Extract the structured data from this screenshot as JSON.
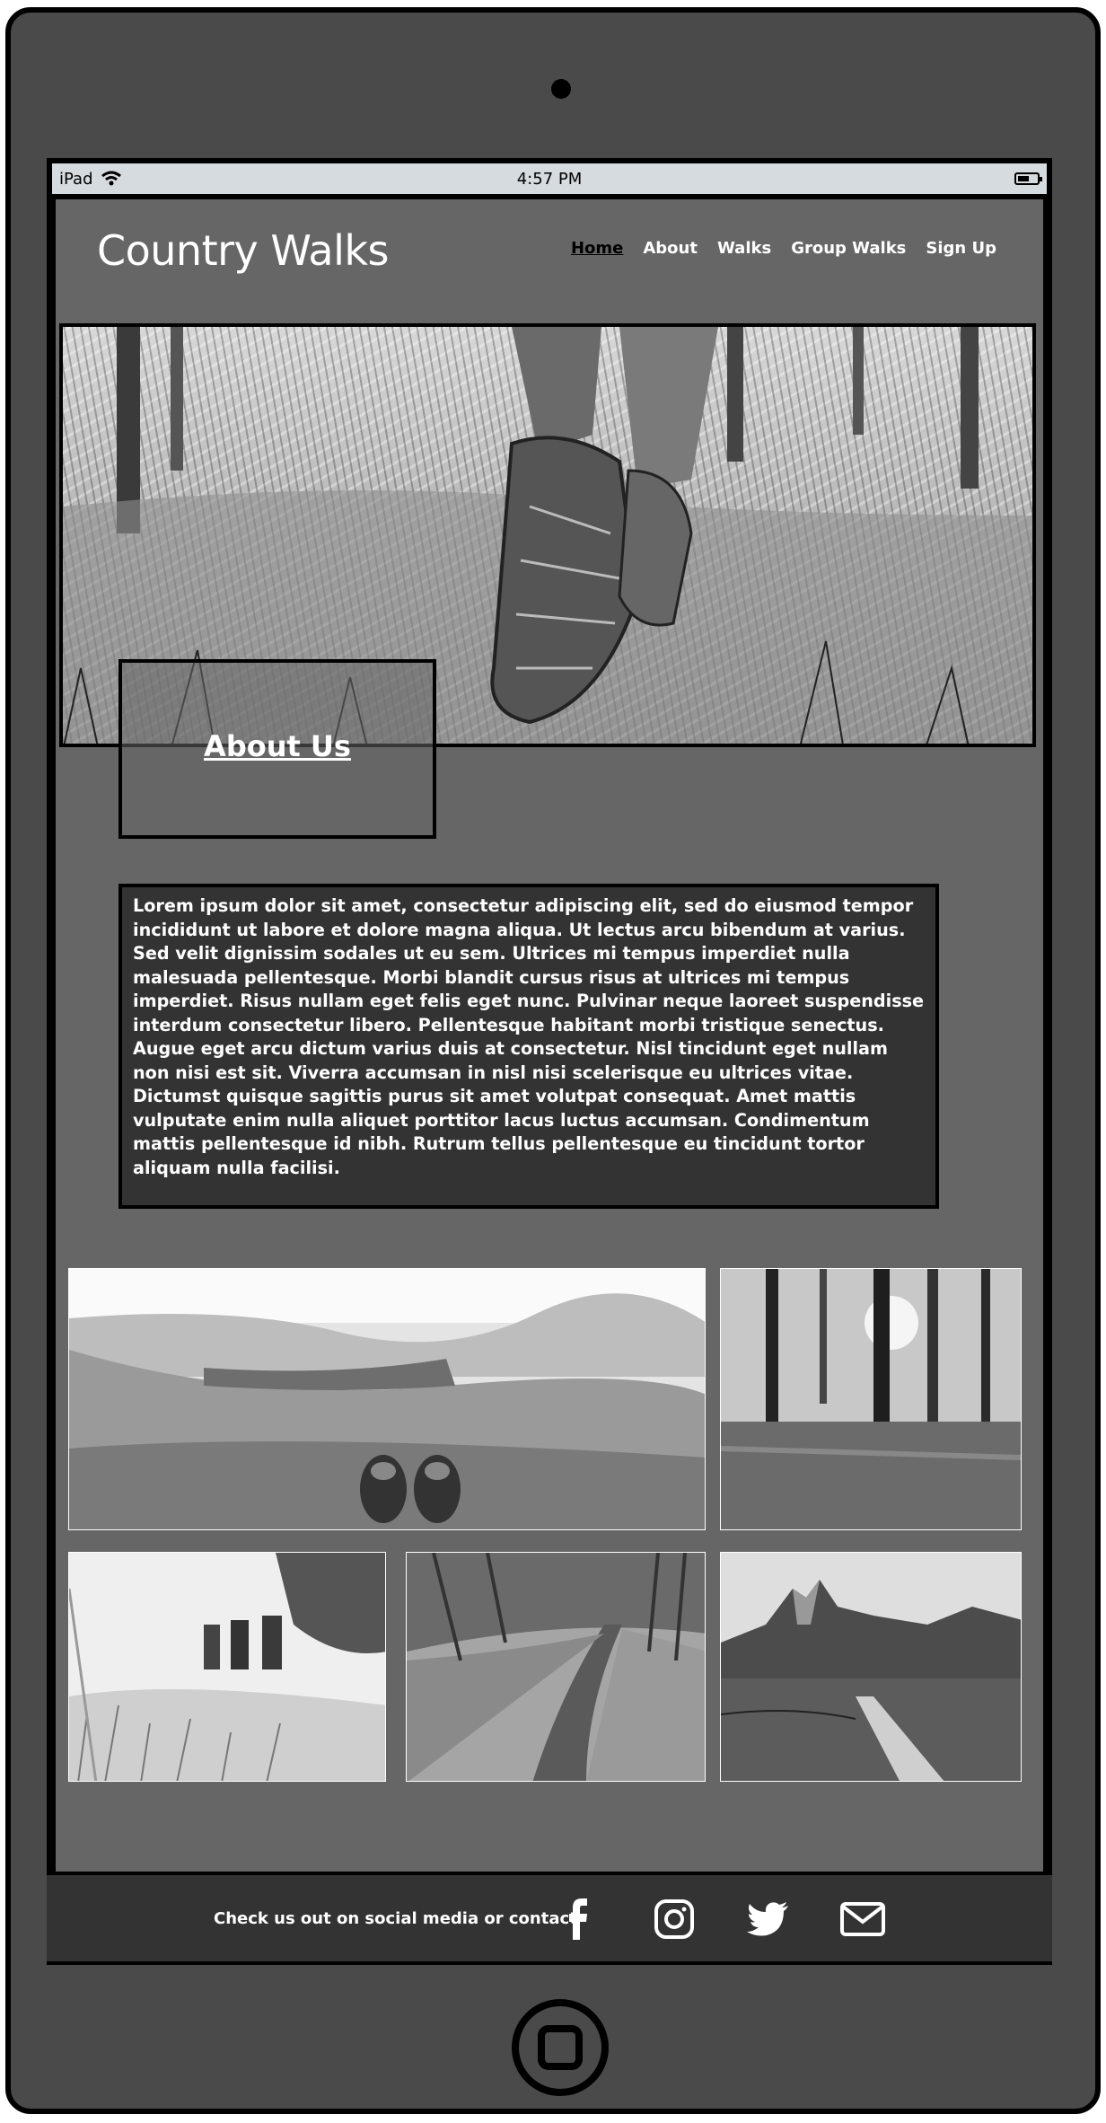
{
  "statusbar": {
    "device": "iPad",
    "time": "4:57 PM",
    "icons": [
      "wifi-icon",
      "battery-icon"
    ]
  },
  "header": {
    "logo": "Country Walks",
    "nav": [
      {
        "label": "Home",
        "active": true
      },
      {
        "label": "About",
        "active": false
      },
      {
        "label": "Walks",
        "active": false
      },
      {
        "label": "Group Walks",
        "active": false
      },
      {
        "label": "Sign Up",
        "active": false
      }
    ]
  },
  "about": {
    "title": "About Us",
    "body": "Lorem ipsum dolor sit amet, consectetur adipiscing elit, sed do eiusmod tempor incididunt ut labore et dolore magna aliqua. Ut lectus arcu bibendum at varius. Sed velit dignissim sodales ut eu sem. Ultrices mi tempus imperdiet nulla malesuada pellentesque. Morbi blandit cursus risus at ultrices mi tempus imperdiet. Risus nullam eget felis eget nunc. Pulvinar neque laoreet suspendisse interdum consectetur libero. Pellentesque habitant morbi tristique senectus. Augue eget arcu dictum varius duis at consectetur. Nisl tincidunt eget nullam non nisi est sit. Viverra accumsan in nisl nisi scelerisque eu ultrices vitae. Dictumst quisque sagittis purus sit amet volutpat consequat. Amet mattis vulputate enim nulla aliquet porttitor lacus luctus accumsan. Condimentum mattis pellentesque id nibh. Rutrum tellus pellentesque eu tincidunt tortor aliquam nulla facilisi."
  },
  "gallery": {
    "photos": [
      "landscape-boots-photo",
      "forest-sunlight-photo",
      "group-hikers-photo",
      "woodland-path-photo",
      "mountain-road-photo"
    ]
  },
  "footer": {
    "text": "Check us out on social media or contact",
    "icons": [
      "facebook-icon",
      "instagram-icon",
      "twitter-icon",
      "email-icon"
    ]
  },
  "colors": {
    "frame": "#4a4a4a",
    "page": "#666666",
    "panel": "#333333",
    "statusbar": "#d6dbdf"
  }
}
